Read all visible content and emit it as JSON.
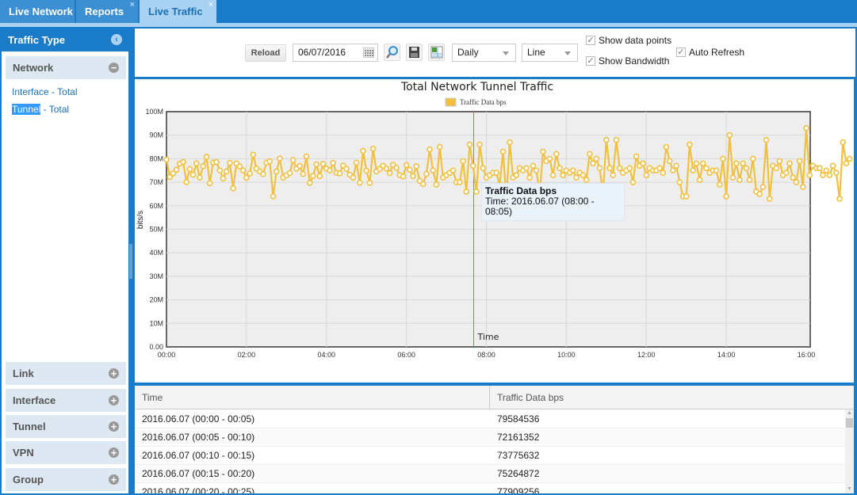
{
  "tabs": [
    {
      "label": "Live Network",
      "closable": false,
      "active": false
    },
    {
      "label": "Reports",
      "closable": true,
      "active": false
    },
    {
      "label": "Live Traffic",
      "closable": true,
      "active": true
    }
  ],
  "close_glyph": "×",
  "sidebar": {
    "title": "Traffic Type",
    "collapse_glyph": "‹",
    "groups": [
      {
        "label": "Network",
        "expanded": true,
        "toggle": "−",
        "links": [
          {
            "label": "Interface - Total",
            "selected": false
          },
          {
            "highlight": "Tunnel",
            "rest": " - Total",
            "selected": true
          }
        ]
      },
      {
        "label": "Link",
        "expanded": false,
        "toggle": "+"
      },
      {
        "label": "Interface",
        "expanded": false,
        "toggle": "+"
      },
      {
        "label": "Tunnel",
        "expanded": false,
        "toggle": "+"
      },
      {
        "label": "VPN",
        "expanded": false,
        "toggle": "+"
      },
      {
        "label": "Group",
        "expanded": false,
        "toggle": "+"
      }
    ]
  },
  "toolbar": {
    "reload_label": "Reload",
    "date_value": "06/07/2016",
    "period_value": "Daily",
    "chart_type_value": "Line",
    "show_data_points_label": "Show data points",
    "show_data_points_checked": true,
    "show_bandwidth_label": "Show Bandwidth",
    "show_bandwidth_checked": true,
    "auto_refresh_label": "Auto Refresh",
    "auto_refresh_checked": true,
    "check_glyph": "✓"
  },
  "colors": {
    "accent": "#1a7bc9",
    "series": "#f0c040",
    "crosshair": "#e06060"
  },
  "tooltip": {
    "title": "Traffic Data bps",
    "time_line1": "Time: 2016.06.07 (08:00 -",
    "time_line2": "08:05)"
  },
  "chart_data": {
    "type": "line",
    "title": "Total Network Tunnel Traffic",
    "xlabel": "Time",
    "ylabel": "bits/s",
    "legend": [
      "Traffic Data bps"
    ],
    "legend_position": "top-center",
    "ylim": [
      0,
      100000000
    ],
    "yticks": [
      "0.00",
      "10M",
      "20M",
      "30M",
      "40M",
      "50M",
      "60M",
      "70M",
      "80M",
      "90M",
      "100M"
    ],
    "xlim_minutes": [
      0,
      965
    ],
    "xticks": [
      "00:00",
      "02:00",
      "04:00",
      "06:00",
      "08:00",
      "10:00",
      "12:00",
      "14:00",
      "16:00"
    ],
    "interval_minutes": 5,
    "grid": true,
    "crosshair_time": "08:00",
    "series": [
      {
        "name": "Traffic Data bps",
        "values_M": [
          79.6,
          72.2,
          73.8,
          75.3,
          77.9,
          78.6,
          70.1,
          75.6,
          73.2,
          78.0,
          72.0,
          76.8,
          80.8,
          69.6,
          78.4,
          78.6,
          75.0,
          71.6,
          74.6,
          78.2,
          67.4,
          78.0,
          76.7,
          75.0,
          71.9,
          73.7,
          81.7,
          75.8,
          74.6,
          73.5,
          78.3,
          78.9,
          64.0,
          74.6,
          80.1,
          72.0,
          72.9,
          73.9,
          79.4,
          75.8,
          76.9,
          73.5,
          81.0,
          69.7,
          72.7,
          77.6,
          72.6,
          77.8,
          75.8,
          75.0,
          78.2,
          74.0,
          73.8,
          77.1,
          75.7,
          73.2,
          72.0,
          78.3,
          69.8,
          83.3,
          74.9,
          69.7,
          84.3,
          74.6,
          75.6,
          77.0,
          75.8,
          73.9,
          77.4,
          76.2,
          73.0,
          72.5,
          77.3,
          75.3,
          72.6,
          76.8,
          70.6,
          69.2,
          73.5,
          84.0,
          75.0,
          69.0,
          85.0,
          72.0,
          73.0,
          74.0,
          75.0,
          70.0,
          70.0,
          79.0,
          66.0,
          86.0,
          77.0,
          66.0,
          86.0,
          76.0,
          72.0,
          73.0,
          74.0,
          74.0,
          69.0,
          83.0,
          63.0,
          87.0,
          72.0,
          73.0,
          76.0,
          75.0,
          76.0,
          72.0,
          77.0,
          75.0,
          65.0,
          83.0,
          79.0,
          80.0,
          73.0,
          82.0,
          76.0,
          73.0,
          75.0,
          74.0,
          75.0,
          72.0,
          74.0,
          73.0,
          71.0,
          82.0,
          78.0,
          80.0,
          76.0,
          65.0,
          88.0,
          76.0,
          73.0,
          88.0,
          76.0,
          74.0,
          75.0,
          76.0,
          70.0,
          81.0,
          77.0,
          78.0,
          73.0,
          76.0,
          75.0,
          75.0,
          76.0,
          74.0,
          85.0,
          79.0,
          75.0,
          77.0,
          70.0,
          64.0,
          64.0,
          86.0,
          75.0,
          78.0,
          71.0,
          78.0,
          76.0,
          74.0,
          75.0,
          75.0,
          69.0,
          80.0,
          64.0,
          90.0,
          72.0,
          78.0,
          71.0,
          78.0,
          76.0,
          71.0,
          80.0,
          66.0,
          65.0,
          68.0,
          88.0,
          63.0,
          77.0,
          76.0,
          79.0,
          73.0,
          74.0,
          78.0,
          72.0,
          70.0,
          79.0,
          68.0,
          93.0,
          73.0,
          77.0,
          76.0,
          76.0,
          73.0,
          75.0,
          73.0,
          77.0,
          74.0,
          63.0,
          87.0,
          78.0,
          80.0
        ]
      }
    ]
  },
  "table": {
    "columns": [
      "Time",
      "Traffic Data bps"
    ],
    "rows": [
      [
        "2016.06.07 (00:00 - 00:05)",
        "79584536"
      ],
      [
        "2016.06.07 (00:05 - 00:10)",
        "72161352"
      ],
      [
        "2016.06.07 (00:10 - 00:15)",
        "73775632"
      ],
      [
        "2016.06.07 (00:15 - 00:20)",
        "75264872"
      ],
      [
        "2016.06.07 (00:20 - 00:25)",
        "77909256"
      ]
    ],
    "scroll_up_glyph": "▲",
    "scroll_down_glyph": "▼"
  }
}
